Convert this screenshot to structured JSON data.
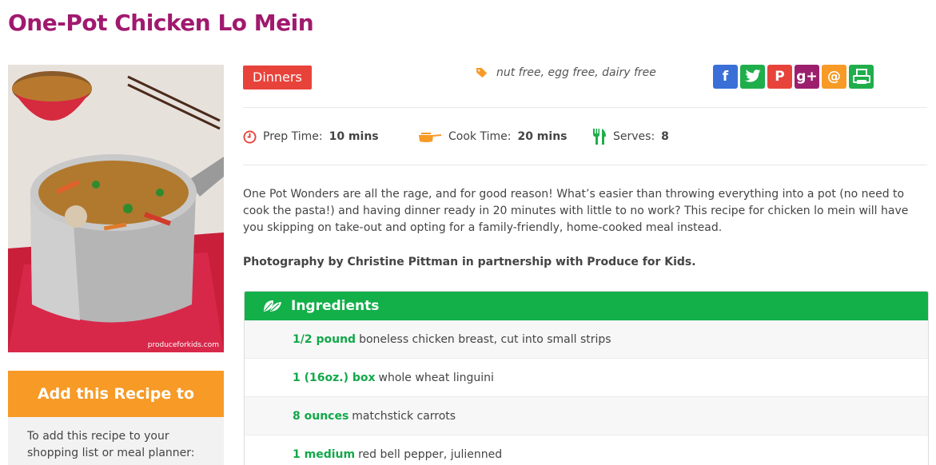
{
  "recipe": {
    "title": "One-Pot Chicken Lo Mein",
    "photo_watermark": "produceforkids.com",
    "category": "Dinners",
    "diet_tags": "nut free, egg free, dairy free",
    "prep_label": "Prep Time:",
    "prep_value": "10 mins",
    "cook_label": "Cook Time:",
    "cook_value": "20 mins",
    "serves_label": "Serves:",
    "serves_value": "8",
    "description": "One Pot Wonders are all the rage, and for good reason! What’s easier than throwing everything into a pot (no need to cook the pasta!) and having dinner ready in 20 minutes with little to no work? This recipe for chicken lo mein will have you skipping on take-out and opting for a family-friendly, home-cooked meal instead.",
    "credit": "Photography by Christine Pittman in partnership with Produce for Kids."
  },
  "share": [
    {
      "name": "facebook-icon",
      "glyph": "f",
      "color": "#3a6fd8"
    },
    {
      "name": "twitter-icon",
      "glyph": "",
      "color": "#1fae4b"
    },
    {
      "name": "pinterest-icon",
      "glyph": "P",
      "color": "#e8433b"
    },
    {
      "name": "google-plus-icon",
      "glyph": "g+",
      "color": "#9c1f6d"
    },
    {
      "name": "email-icon",
      "glyph": "@",
      "color": "#f79a26"
    },
    {
      "name": "print-icon",
      "glyph": "",
      "color": "#1fae4b"
    }
  ],
  "add_box": {
    "header": "Add this Recipe to",
    "body": "To add this recipe to your shopping list or meal planner:"
  },
  "ingredients": {
    "header": "Ingredients",
    "items": [
      {
        "qty": "1/2 pound",
        "text": "boneless chicken breast, cut into small strips"
      },
      {
        "qty": "1 (16oz.) box",
        "text": "whole wheat linguini"
      },
      {
        "qty": "8 ounces",
        "text": "matchstick carrots"
      },
      {
        "qty": "1 medium",
        "text": "red bell pepper, julienned"
      }
    ]
  },
  "colors": {
    "title": "#a0196e",
    "category": "#e8433b",
    "ingredients_header": "#13b04a",
    "quantity": "#13a84a",
    "add_header": "#f79a26"
  }
}
